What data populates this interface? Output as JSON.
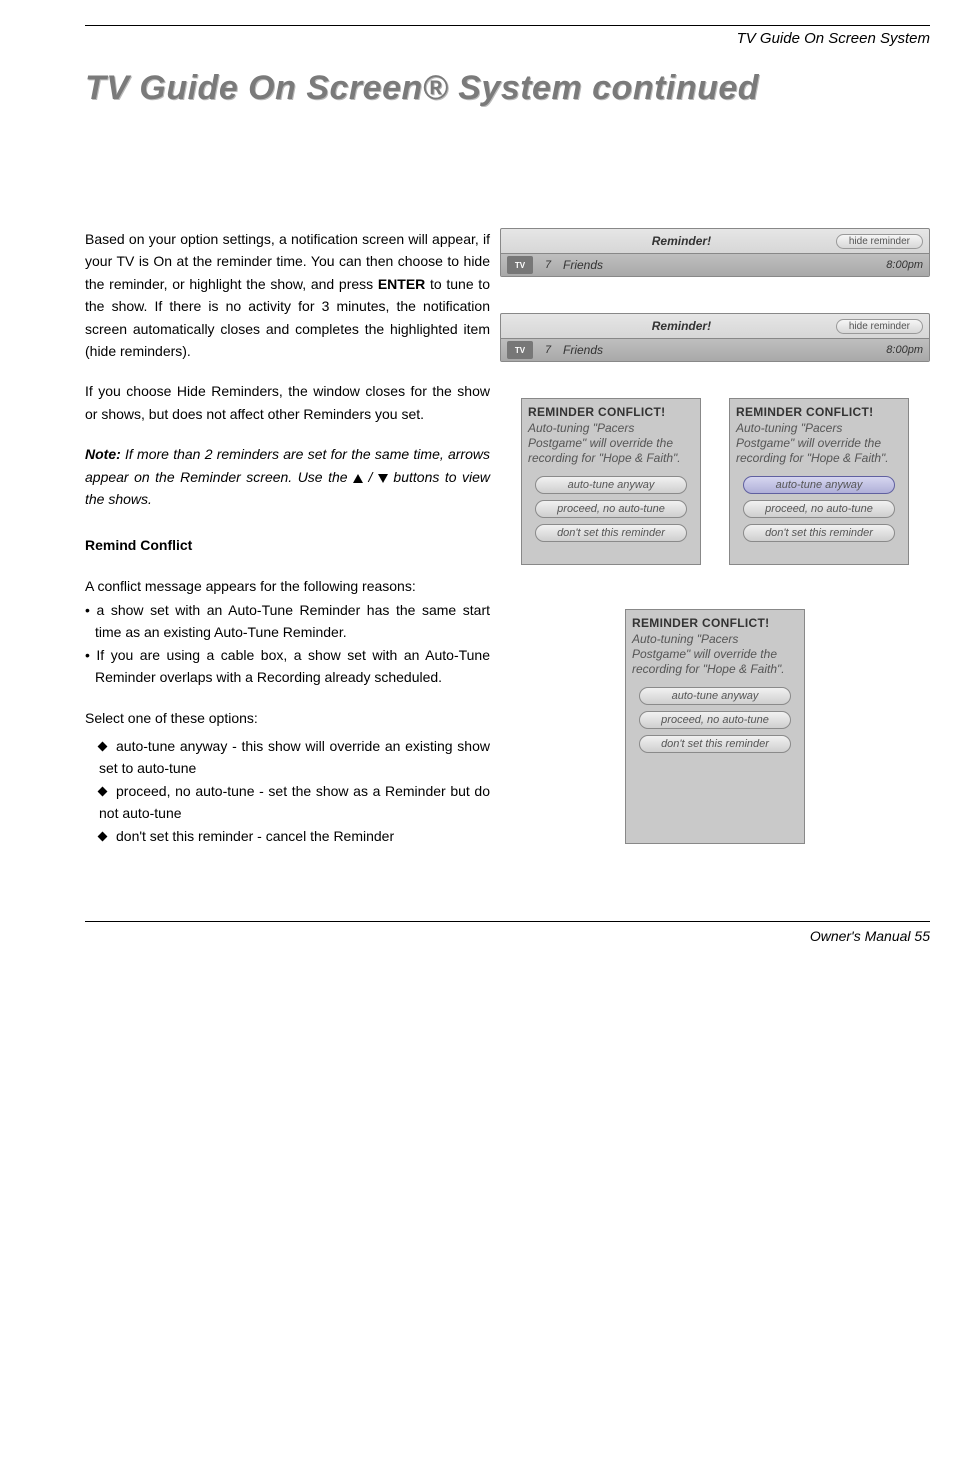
{
  "header": {
    "section": "TV Guide On Screen System"
  },
  "title": {
    "text": "TV Guide On Screen® System continued"
  },
  "body": {
    "p1_a": "Based on your option settings, a notification screen will appear, if your TV is On at the reminder time. You can then choose to hide the reminder, or highlight the show, and press ",
    "p1_enter": "ENTER",
    "p1_b": " to tune to the show. If there is no activity for 3 minutes, the notification screen automatically closes and completes the highlighted item (hide reminders).",
    "p2": "If you choose Hide Reminders, the window closes for the show or shows, but does not affect other Reminders you set.",
    "note_a": "Note:",
    "note_b": " If more than 2 reminders are set for the same time, arrows appear on the Reminder screen. Use the ",
    "note_c": " buttons to view the shows.",
    "subhead": "Remind Conflict",
    "p3": "A conflict message appears for the following reasons:",
    "bullets": [
      "a show set with an Auto-Tune Reminder has the same start time as an existing Auto-Tune Reminder.",
      "If you are using a cable box, a show set with an Auto-Tune Reminder overlaps with a Recording already scheduled."
    ],
    "p4": "Select one of these options:",
    "options": [
      "auto-tune anyway - this show will override an existing show set to auto-tune",
      "proceed, no auto-tune - set the show as a Reminder but do not auto-tune",
      "don't set this reminder - cancel the Reminder"
    ]
  },
  "screens": {
    "reminder1": {
      "title": "Reminder!",
      "hide": "hide reminder",
      "logo": "TV",
      "chan": "7",
      "show": "Friends",
      "time": "8:00pm"
    },
    "reminder2": {
      "title": "Reminder!",
      "hide": "hide reminder",
      "logo": "TV",
      "chan": "7",
      "show": "Friends",
      "time": "8:00pm"
    },
    "conflict": {
      "title": "REMINDER CONFLICT!",
      "msg": "Auto-tuning \"Pacers Postgame\" will override the recording for \"Hope & Faith\".",
      "btn1": "auto-tune anyway",
      "btn2": "proceed, no auto-tune",
      "btn3": "don't set this reminder"
    }
  },
  "footer": {
    "text": "Owner's Manual   55"
  }
}
